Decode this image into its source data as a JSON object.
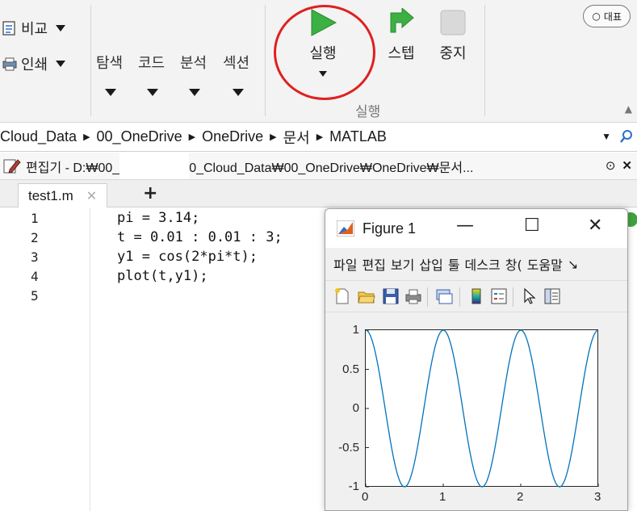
{
  "ribbon": {
    "compare_label": "비교",
    "print_label": "인쇄",
    "navigate_label": "탐색",
    "code_label": "코드",
    "analyze_label": "분석",
    "section_label": "섹션",
    "run_label": "실행",
    "step_label": "스텝",
    "stop_label": "중지",
    "group_label": "실행",
    "representative_label": "대표"
  },
  "pathbar": {
    "segments": [
      "Cloud_Data",
      "00_OneDrive",
      "OneDrive",
      "문서",
      "MATLAB"
    ]
  },
  "editor": {
    "title_prefix": "편집기 - D:₩00_",
    "title_suffix": "0_Cloud_Data₩00_OneDrive₩OneDrive₩문서...",
    "tab_name": "test1.m",
    "line_numbers": [
      "1",
      "2",
      "3",
      "4",
      "5"
    ],
    "code_lines": [
      "pi = 3.14;",
      "t = 0.01 : 0.01 : 3;",
      "y1 = cos(2*pi*t);",
      "plot(t,y1);",
      ""
    ]
  },
  "figure": {
    "title": "Figure 1",
    "menu_items": [
      "파일",
      "편집",
      "보기",
      "삽입",
      "툴",
      "데스크",
      "창(",
      "도움말"
    ],
    "controls": {
      "minimize": "—",
      "maximize": "☐",
      "close": "✕"
    }
  },
  "chart_data": {
    "type": "line",
    "title": "",
    "xlabel": "",
    "ylabel": "",
    "xlim": [
      0,
      3
    ],
    "ylim": [
      -1,
      1
    ],
    "x_ticks": [
      "0",
      "1",
      "2",
      "3"
    ],
    "y_ticks": [
      "1",
      "0.5",
      "0",
      "-0.5",
      "-1"
    ],
    "x_tick_values": [
      0,
      1,
      2,
      3
    ],
    "y_tick_values": [
      1,
      0.5,
      0,
      -0.5,
      -1
    ],
    "grid": false,
    "series": [
      {
        "color": "#0072bd",
        "x_start": 0.01,
        "x_end": 3,
        "x_step": 0.01,
        "expression": "cos(2*3.14*t)"
      }
    ]
  },
  "colors": {
    "run_green": "#3cb043",
    "highlight_red": "#e02020",
    "plot_line": "#0072bd"
  }
}
